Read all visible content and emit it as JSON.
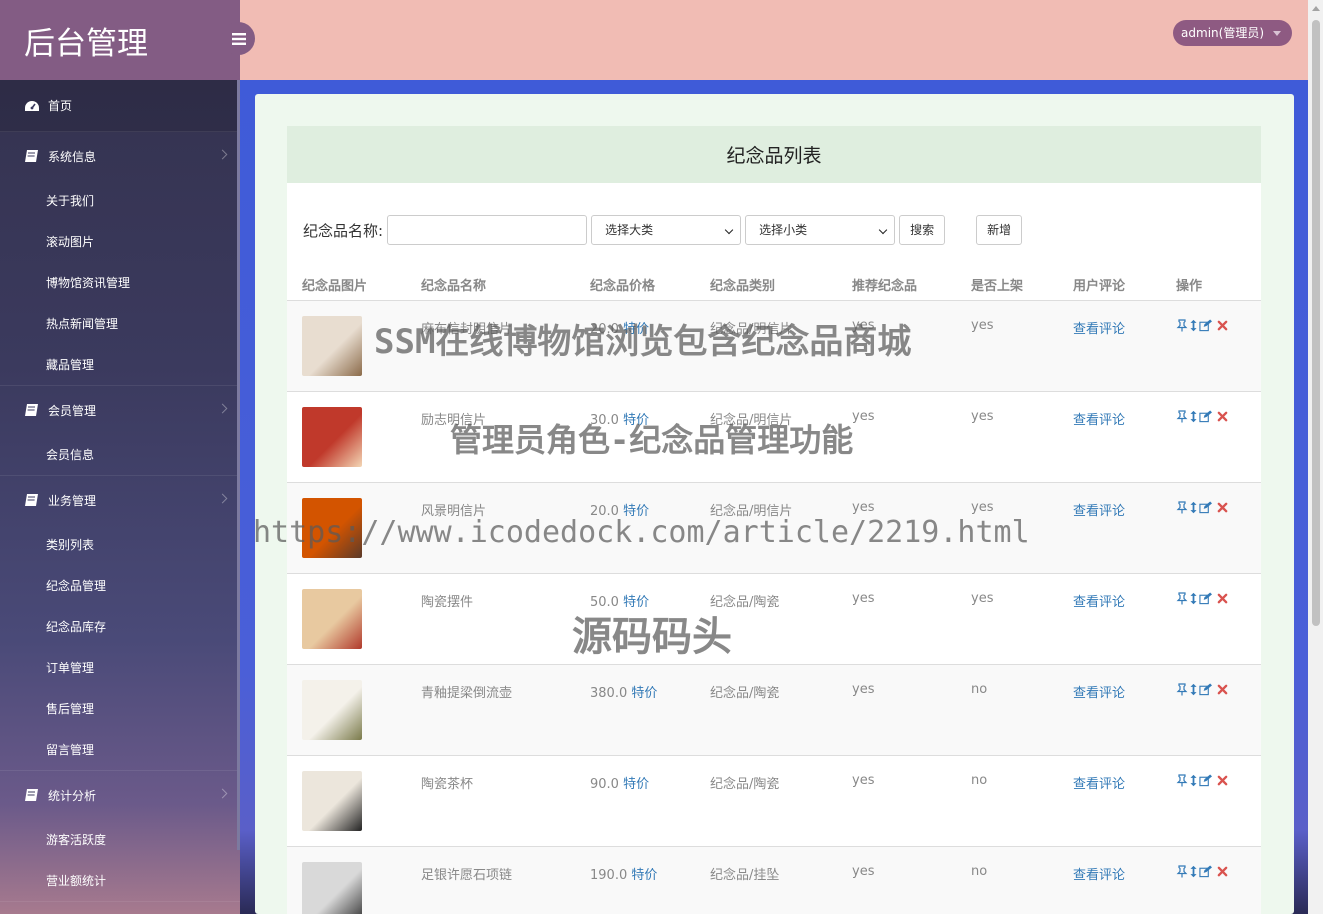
{
  "brand": {
    "title": "后台管理"
  },
  "header": {
    "user_label": "admin(管理员)"
  },
  "sidebar": {
    "home": "首页",
    "groups": [
      {
        "label": "系统信息",
        "items": [
          "关于我们",
          "滚动图片",
          "博物馆资讯管理",
          "热点新闻管理",
          "藏品管理"
        ]
      },
      {
        "label": "会员管理",
        "items": [
          "会员信息"
        ]
      },
      {
        "label": "业务管理",
        "items": [
          "类别列表",
          "纪念品管理",
          "纪念品库存",
          "订单管理",
          "售后管理",
          "留言管理"
        ]
      },
      {
        "label": "统计分析",
        "items": [
          "游客活跃度",
          "营业额统计"
        ]
      }
    ]
  },
  "page": {
    "title": "纪念品列表",
    "search_label": "纪念品名称:",
    "search_value": "",
    "category_select": "选择大类",
    "subcategory_select": "选择小类",
    "search_button": "搜索",
    "add_button": "新增"
  },
  "table": {
    "columns": [
      "纪念品图片",
      "纪念品名称",
      "纪念品价格",
      "纪念品类别",
      "推荐纪念品",
      "是否上架",
      "用户评论",
      "操作"
    ],
    "special_label": "特价",
    "review_link": "查看评论",
    "rows": [
      {
        "name": "麻布信封明信片",
        "price": "20.0",
        "category": "纪念品/明信片",
        "recommend": "yes",
        "on_sale": "yes",
        "thumb_color": "#e8ddd0",
        "thumb_accent": "#8b6b4a"
      },
      {
        "name": "励志明信片",
        "price": "30.0",
        "category": "纪念品/明信片",
        "recommend": "yes",
        "on_sale": "yes",
        "thumb_color": "#c0392b",
        "thumb_accent": "#f3d6b5"
      },
      {
        "name": "风景明信片",
        "price": "20.0",
        "category": "纪念品/明信片",
        "recommend": "yes",
        "on_sale": "yes",
        "thumb_color": "#d35400",
        "thumb_accent": "#5b3a29"
      },
      {
        "name": "陶瓷摆件",
        "price": "50.0",
        "category": "纪念品/陶瓷",
        "recommend": "yes",
        "on_sale": "yes",
        "thumb_color": "#e8c9a0",
        "thumb_accent": "#b0392b"
      },
      {
        "name": "青釉提梁倒流壶",
        "price": "380.0",
        "category": "纪念品/陶瓷",
        "recommend": "yes",
        "on_sale": "no",
        "thumb_color": "#f4f1ea",
        "thumb_accent": "#7a7a4a"
      },
      {
        "name": "陶瓷茶杯",
        "price": "90.0",
        "category": "纪念品/陶瓷",
        "recommend": "yes",
        "on_sale": "no",
        "thumb_color": "#ece6dc",
        "thumb_accent": "#222222"
      },
      {
        "name": "足银许愿石项链",
        "price": "190.0",
        "category": "纪念品/挂坠",
        "recommend": "yes",
        "on_sale": "no",
        "thumb_color": "#d9d9d9",
        "thumb_accent": "#333333"
      }
    ]
  },
  "watermarks": {
    "line1": "SSM在线博物馆浏览包含纪念品商城",
    "line2": "管理员角色-纪念品管理功能",
    "line3": "https://www.icodedock.com/article/2219.html",
    "line4": "源码码头"
  },
  "colors": {
    "brand": "#835c84",
    "header": "#f1bcb4",
    "link": "#337ab7",
    "danger": "#d9534f"
  }
}
